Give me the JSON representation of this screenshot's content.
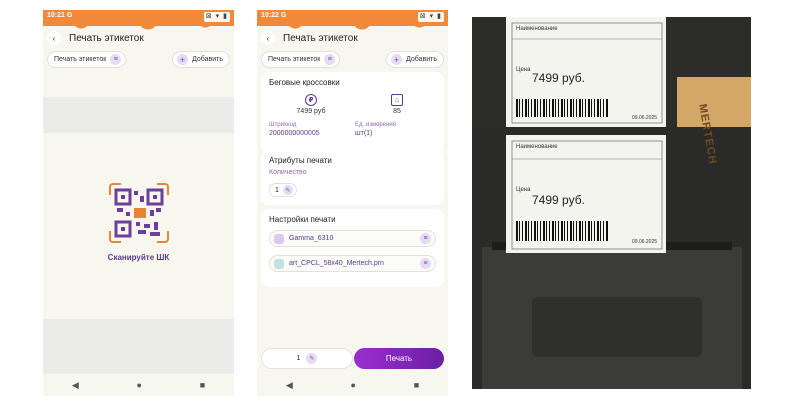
{
  "phone1": {
    "status_time": "10:21",
    "status_g": "G",
    "status_icons": "⊠ ▾ ▮",
    "back": "‹",
    "title": "Печать этикеток",
    "chip_label": "Печать этикеток",
    "add_label": "Добавить",
    "scan_label": "Сканируйте ШК"
  },
  "phone2": {
    "status_time": "10:22",
    "status_g": "G",
    "status_icons": "⊠ ▾ ▮",
    "back": "‹",
    "title": "Печать этикеток",
    "chip_label": "Печать этикеток",
    "add_label": "Добавить",
    "product": {
      "name": "Беговые кроссовки",
      "price": "7499 руб",
      "stock": "85",
      "barcode_label": "Штрихкод",
      "barcode": "2000000000005",
      "unit_label": "Ед. измерения",
      "unit": "шт(1)"
    },
    "attributes": {
      "title": "Атрибуты печати",
      "qty_label": "Количество",
      "qty": "1"
    },
    "settings": {
      "title": "Настройки печати",
      "printer": "Gamma_6310",
      "template": "art_CPCL_58x40_Mertech.prn"
    },
    "bottom_qty": "1",
    "print_button": "Печать"
  },
  "nav": {
    "back": "◀",
    "home": "●",
    "recent": "■"
  },
  "photo": {
    "label1": {
      "name_label": "Наименование",
      "price_label": "Цена",
      "price": "7499 руб.",
      "date": "09.06.2025"
    },
    "label2": {
      "name_label": "Наименование",
      "price_label": "Цена",
      "price": "7499 руб.",
      "date": "09.06.2025"
    },
    "background_text": "MERTECH"
  },
  "colors": {
    "accent": "#6b1fa3",
    "orange": "#f08a3a",
    "bg": "#f7f7ef"
  }
}
